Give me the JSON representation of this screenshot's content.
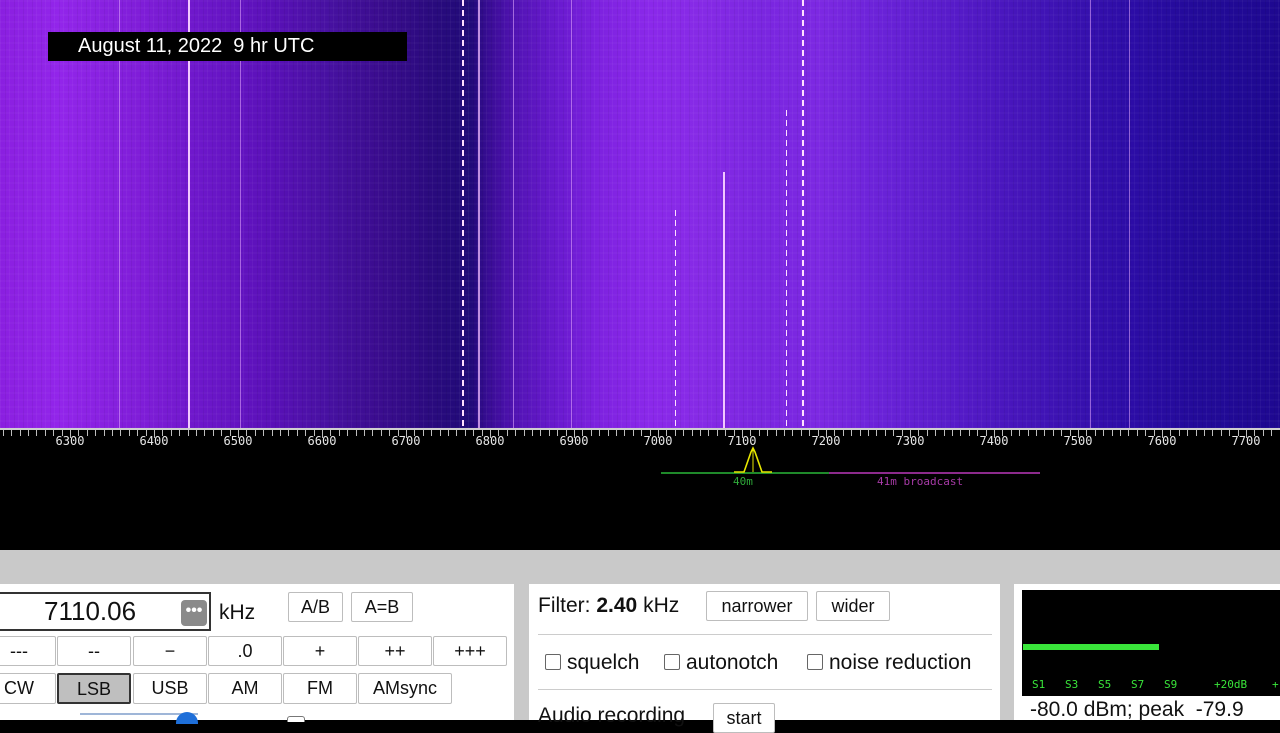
{
  "overlay": {
    "date_caption": "August 11, 2022  9 hr UTC"
  },
  "waterfall": {
    "colors": {
      "strong": "#f2c8ff",
      "background_left": "#8a1fe0",
      "background_right": "#1e0890"
    }
  },
  "scale": {
    "tick_labels": [
      "6300",
      "6400",
      "6500",
      "6600",
      "6700",
      "6800",
      "6900",
      "7000",
      "7100",
      "7200",
      "7300",
      "7400",
      "7500",
      "7600",
      "7700"
    ],
    "bands": [
      {
        "label": "40m",
        "color": "#1f8a2a"
      },
      {
        "label": "41m broadcast",
        "color": "#8c2a8c"
      }
    ]
  },
  "frequency": {
    "value": "7110.06",
    "unit": "kHz",
    "menu_icon": "more-dots-icon"
  },
  "vfo_buttons": {
    "ab": "A/B",
    "a_eq_b": "A=B"
  },
  "step_buttons": [
    "---",
    "--",
    "−",
    ".0",
    "+",
    "++",
    "+++"
  ],
  "mode_buttons": [
    {
      "label": "CW",
      "selected": false
    },
    {
      "label": "LSB",
      "selected": true
    },
    {
      "label": "USB",
      "selected": false
    },
    {
      "label": "AM",
      "selected": false
    },
    {
      "label": "FM",
      "selected": false
    },
    {
      "label": "AMsync",
      "selected": false
    }
  ],
  "filter": {
    "label": "Filter:",
    "value": "2.40",
    "unit": "kHz",
    "narrower": "narrower",
    "wider": "wider"
  },
  "options": {
    "squelch": "squelch",
    "autonotch": "autonotch",
    "noise_reduction": "noise reduction"
  },
  "recording": {
    "label": "Audio recording",
    "start": "start"
  },
  "smeter": {
    "labels": [
      "S1",
      "S3",
      "S5",
      "S7",
      "S9",
      "+20dB",
      "+"
    ],
    "level_fraction": 0.53,
    "bar_color": "#39e53a",
    "readout": "-80.0 dBm; peak  -79.9"
  }
}
